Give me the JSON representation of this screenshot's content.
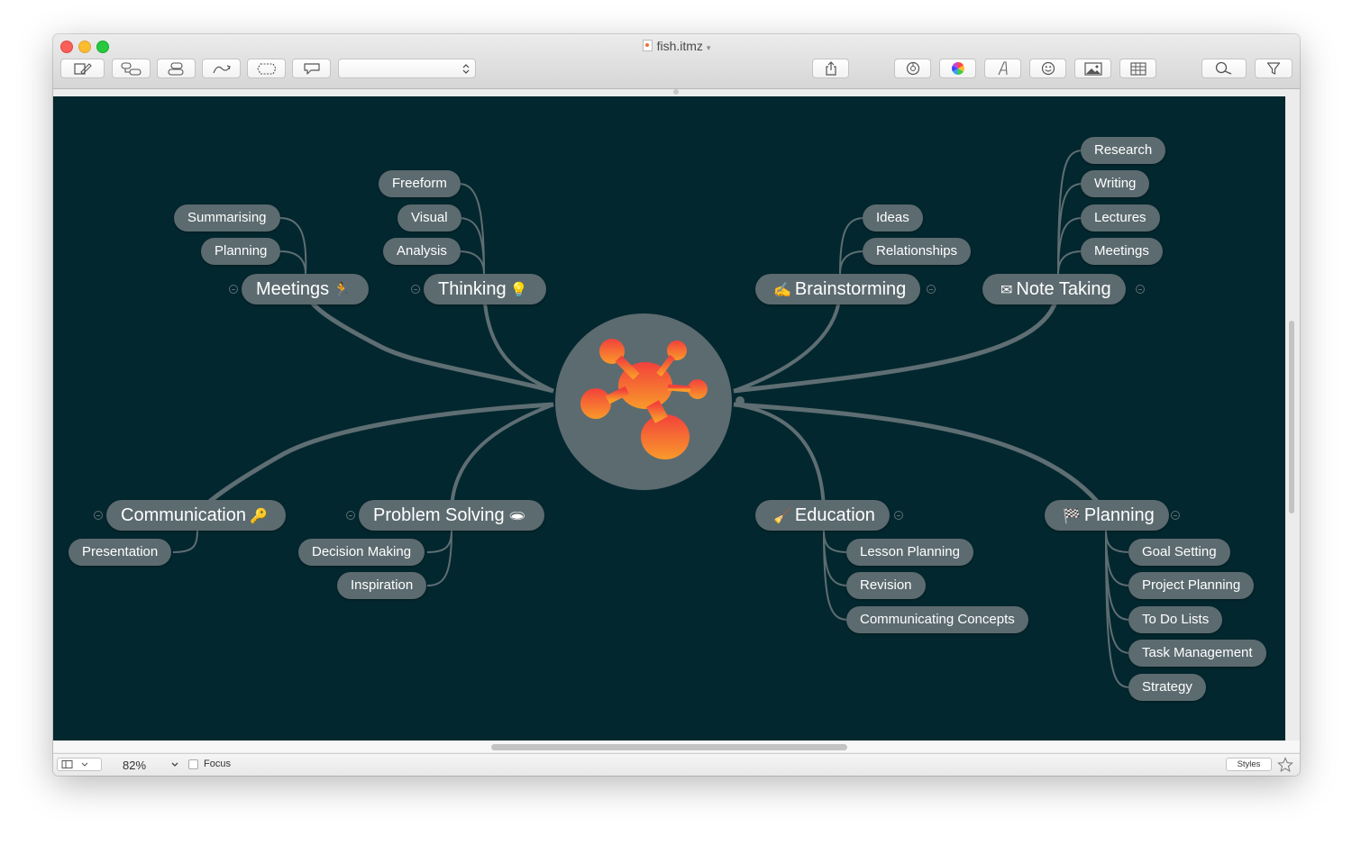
{
  "window": {
    "title": "fish.itmz"
  },
  "toolbar": {
    "style_select_value": ""
  },
  "center_topic": {
    "icon": "imindmap-logo-icon"
  },
  "branches": {
    "meetings": {
      "label": "Meetings",
      "emoji": "🏃",
      "children": [
        "Summarising",
        "Planning"
      ]
    },
    "thinking": {
      "label": "Thinking",
      "emoji": "💡",
      "children": [
        "Freeform",
        "Visual",
        "Analysis"
      ]
    },
    "brainstorming": {
      "label": "Brainstorming",
      "emoji": "✍",
      "children": [
        "Ideas",
        "Relationships"
      ]
    },
    "note_taking": {
      "label": "Note Taking",
      "emoji": "✉",
      "children": [
        "Research",
        "Writing",
        "Lectures",
        "Meetings"
      ]
    },
    "communication": {
      "label": "Communication",
      "emoji": "🔑",
      "children": [
        "Presentation"
      ]
    },
    "problem_solving": {
      "label": "Problem Solving",
      "emoji": "🕳",
      "children": [
        "Decision Making",
        "Inspiration"
      ]
    },
    "education": {
      "label": "Education",
      "emoji": "🧹",
      "children": [
        "Lesson Planning",
        "Revision",
        "Communicating Concepts"
      ]
    },
    "planning": {
      "label": "Planning",
      "emoji": "🏁",
      "children": [
        "Goal Setting",
        "Project Planning",
        "To Do Lists",
        "Task Management",
        "Strategy"
      ]
    }
  },
  "statusbar": {
    "zoom": "82%",
    "focus_label": "Focus",
    "styles_label": "Styles"
  },
  "colors": {
    "canvas_bg": "#03272e",
    "node_bg": "#5c6b70",
    "branch_line": "#5e6e73",
    "logo_top": "#f2413c",
    "logo_bottom": "#f99a2a"
  }
}
